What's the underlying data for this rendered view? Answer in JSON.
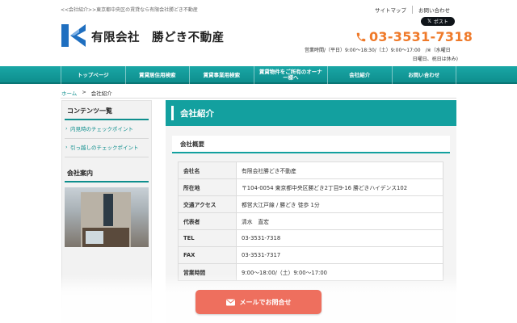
{
  "header": {
    "tagline": "<<会社紹介>>東京都中央区の賃貸なら有限会社勝どき不動産",
    "toplinks": [
      "サイトマップ",
      "お問い合わせ"
    ],
    "x_post": "ポスト",
    "company_name": "有限会社　勝どき不動産",
    "phone": "03-3531-7318",
    "hours_line1": "営業時間/（平日）9:00～18:30/（土）9:00～17:00　/※（水曜日",
    "hours_line2": "日曜日、祝日は休み)"
  },
  "nav": {
    "items": [
      "トップページ",
      "賃貸居住用検索",
      "賃貸事業用検索",
      "賃貸物件をご所有のオーナー様へ",
      "会社紹介",
      "お問い合わせ"
    ]
  },
  "breadcrumb": {
    "home": "ホーム",
    "sep": ">",
    "current": "会社紹介"
  },
  "sidebar": {
    "contents_heading": "コンテンツ一覧",
    "links": [
      "内見時のチェックポイント",
      "引っ越しのチェックポイント"
    ],
    "company_heading": "会社案内"
  },
  "main": {
    "title": "会社紹介",
    "section_heading": "会社概要",
    "rows": [
      {
        "key": "会社名",
        "value": "有限会社勝どき不動産"
      },
      {
        "key": "所在地",
        "value": "〒104-0054 東京都中央区勝どき2丁目9-16 勝どきハイデンス102"
      },
      {
        "key": "交通アクセス",
        "value": "都営大江戸線 / 勝どき 徒歩 1分"
      },
      {
        "key": "代表者",
        "value": "清水　直宏"
      },
      {
        "key": "TEL",
        "value": "03-3531-7318"
      },
      {
        "key": "FAX",
        "value": "03-3531-7317"
      },
      {
        "key": "営業時間",
        "value": "9:00～18:00/（土）9:00～17:00"
      }
    ]
  },
  "cta": {
    "mail_label": "メールでお問合せ"
  },
  "colors": {
    "brand_teal": "#13a09f",
    "phone_orange": "#ef7a2a",
    "cta_coral": "#ee6f5e",
    "logo_blue": "#1f6fc0"
  }
}
